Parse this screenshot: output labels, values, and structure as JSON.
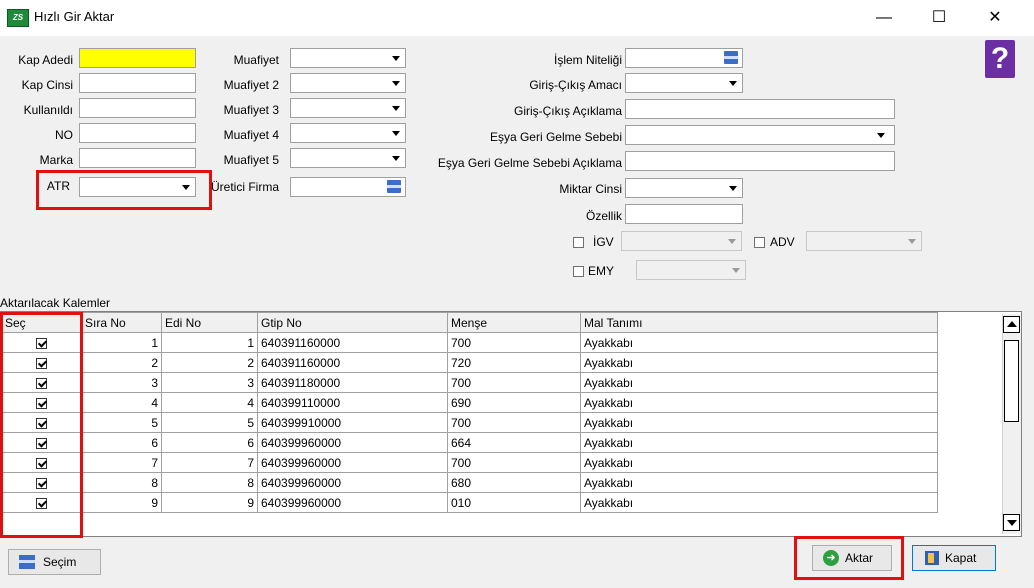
{
  "window": {
    "title": "Hızlı Gir Aktar",
    "icon": "app-logo",
    "controls": {
      "minimize": "—",
      "maximize": "☐",
      "close": "✕"
    }
  },
  "form": {
    "kap_adedi": {
      "label": "Kap Adedi",
      "value": ""
    },
    "kap_cinsi": {
      "label": "Kap Cinsi",
      "value": ""
    },
    "kullanildi": {
      "label": "Kullanıldı",
      "value": ""
    },
    "no": {
      "label": "NO",
      "value": ""
    },
    "marka": {
      "label": "Marka",
      "value": ""
    },
    "atr": {
      "label": "ATR",
      "value": ""
    },
    "muafiyet": {
      "label": "Muafiyet",
      "value": ""
    },
    "muafiyet2": {
      "label": "Muafiyet 2",
      "value": ""
    },
    "muafiyet3": {
      "label": "Muafiyet 3",
      "value": ""
    },
    "muafiyet4": {
      "label": "Muafiyet 4",
      "value": ""
    },
    "muafiyet5": {
      "label": "Muafiyet 5",
      "value": ""
    },
    "uretici_firma": {
      "label": "Üretici Firma",
      "value": ""
    },
    "islem_niteligi": {
      "label": "İşlem Niteliği",
      "value": ""
    },
    "giris_cikis_amaci": {
      "label": "Giriş-Çıkış Amacı",
      "value": ""
    },
    "giris_cikis_aciklama": {
      "label": "Giriş-Çıkış Açıklama",
      "value": ""
    },
    "esya_geri_gelme_sebebi": {
      "label": "Eşya Geri Gelme Sebebi",
      "value": ""
    },
    "esya_geri_gelme_sebebi_aciklama": {
      "label": "Eşya Geri Gelme Sebebi  Açıklama",
      "value": ""
    },
    "miktar_cinsi": {
      "label": "Miktar Cinsi",
      "value": ""
    },
    "ozellik": {
      "label": "Özellik",
      "value": ""
    },
    "igv": {
      "label": "İGV",
      "checked": false
    },
    "adv": {
      "label": "ADV",
      "checked": false
    },
    "emy": {
      "label": "EMY",
      "checked": false
    }
  },
  "grid": {
    "section_label": "Aktarılacak Kalemler",
    "columns": [
      "Seç",
      "Sıra No",
      "Edi No",
      "Gtip No",
      "Menşe",
      "Mal Tanımı"
    ],
    "rows": [
      {
        "sec": true,
        "sira_no": "1",
        "edi_no": "1",
        "gtip_no": "640391160000",
        "mense": "700",
        "mal_tanimi": "Ayakkabı"
      },
      {
        "sec": true,
        "sira_no": "2",
        "edi_no": "2",
        "gtip_no": "640391160000",
        "mense": "720",
        "mal_tanimi": "Ayakkabı"
      },
      {
        "sec": true,
        "sira_no": "3",
        "edi_no": "3",
        "gtip_no": "640391180000",
        "mense": "700",
        "mal_tanimi": "Ayakkabı"
      },
      {
        "sec": true,
        "sira_no": "4",
        "edi_no": "4",
        "gtip_no": "640399110000",
        "mense": "690",
        "mal_tanimi": "Ayakkabı"
      },
      {
        "sec": true,
        "sira_no": "5",
        "edi_no": "5",
        "gtip_no": "640399910000",
        "mense": "700",
        "mal_tanimi": "Ayakkabı"
      },
      {
        "sec": true,
        "sira_no": "6",
        "edi_no": "6",
        "gtip_no": "640399960000",
        "mense": "664",
        "mal_tanimi": "Ayakkabı"
      },
      {
        "sec": true,
        "sira_no": "7",
        "edi_no": "7",
        "gtip_no": "640399960000",
        "mense": "700",
        "mal_tanimi": "Ayakkabı"
      },
      {
        "sec": true,
        "sira_no": "8",
        "edi_no": "8",
        "gtip_no": "640399960000",
        "mense": "680",
        "mal_tanimi": "Ayakkabı"
      },
      {
        "sec": true,
        "sira_no": "9",
        "edi_no": "9",
        "gtip_no": "640399960000",
        "mense": "010",
        "mal_tanimi": "Ayakkabı"
      }
    ]
  },
  "buttons": {
    "secim": "Seçim",
    "aktar": "Aktar",
    "kapat": "Kapat"
  },
  "colors": {
    "highlight": "#e01010",
    "required_field": "#ffff00",
    "help_icon": "#6b2fa3"
  }
}
